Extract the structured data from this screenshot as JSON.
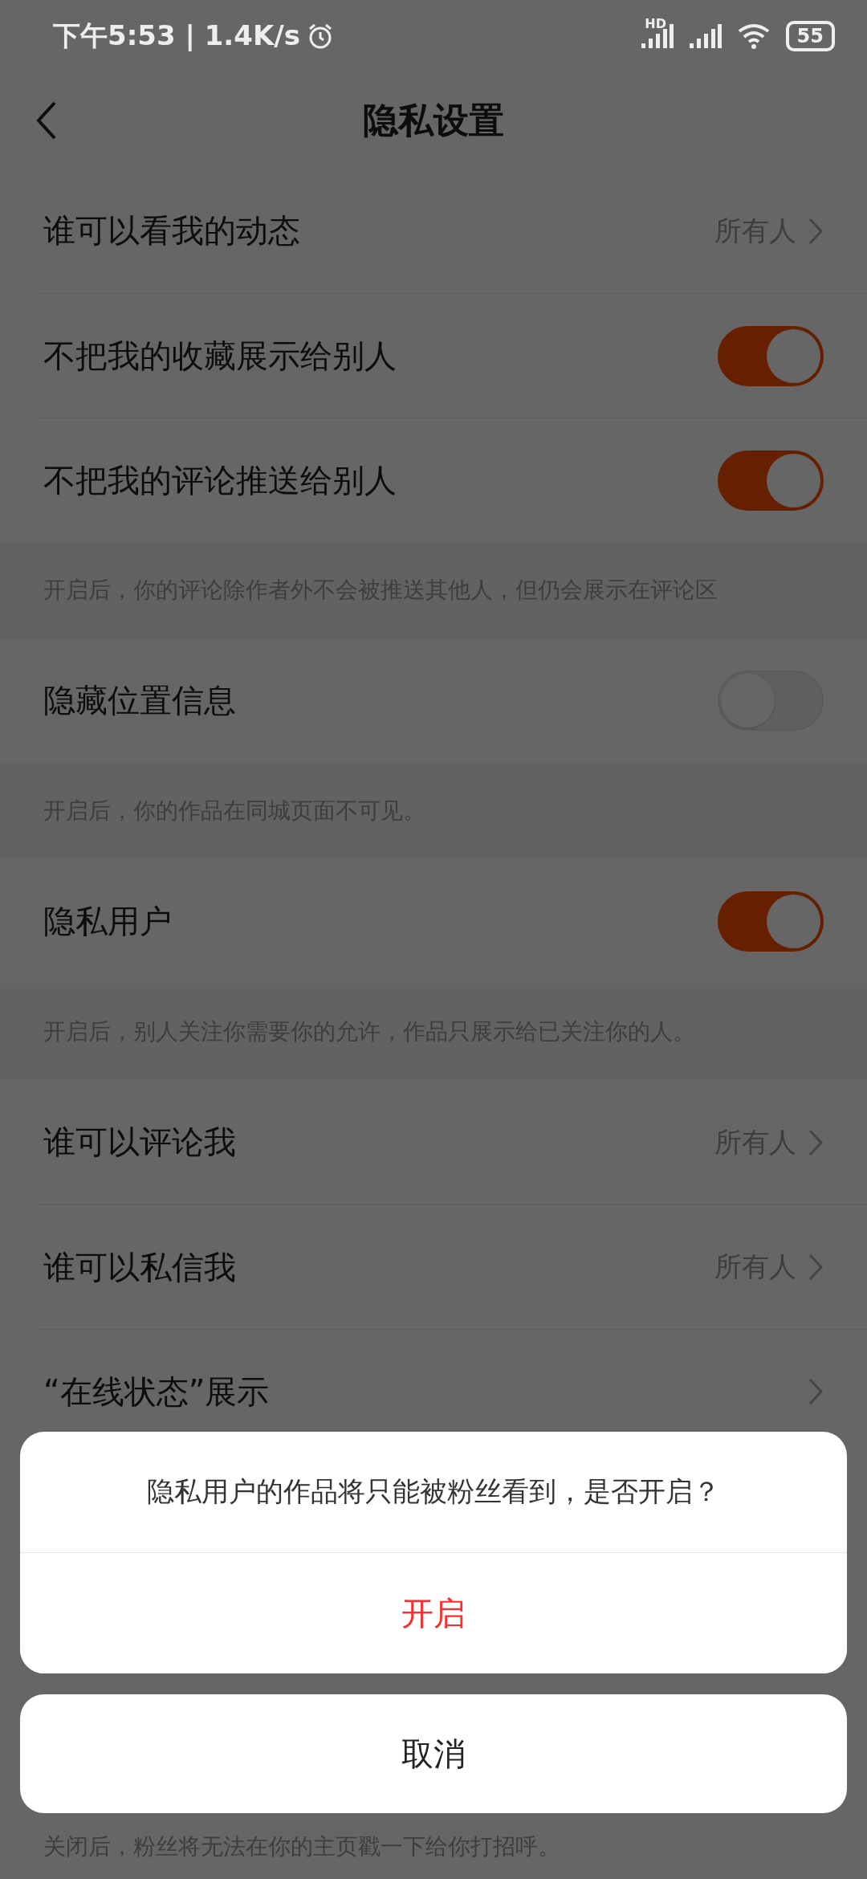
{
  "status_bar": {
    "time": "下午5:53 | 1.4K/s",
    "hd_label": "HD",
    "battery": "55"
  },
  "header": {
    "title": "隐私设置"
  },
  "items": [
    {
      "kind": "link",
      "label": "谁可以看我的动态",
      "value": "所有人"
    },
    {
      "kind": "toggle",
      "label": "不把我的收藏展示给别人",
      "on": true
    },
    {
      "kind": "toggle",
      "label": "不把我的评论推送给别人",
      "on": true
    },
    {
      "kind": "hint",
      "text": "开启后，你的评论除作者外不会被推送其他人，但仍会展示在评论区"
    },
    {
      "kind": "toggle",
      "label": "隐藏位置信息",
      "on": false
    },
    {
      "kind": "hint",
      "text": "开启后，你的作品在同城页面不可见。"
    },
    {
      "kind": "toggle",
      "label": "隐私用户",
      "on": true
    },
    {
      "kind": "hint",
      "text": "开启后，别人关注你需要你的允许，作品只展示给已关注你的人。"
    },
    {
      "kind": "link",
      "label": "谁可以评论我",
      "value": "所有人"
    },
    {
      "kind": "link",
      "label": "谁可以私信我",
      "value": "所有人"
    },
    {
      "kind": "link",
      "label": "“在线状态”展示"
    }
  ],
  "footer_hint": "关闭后，粉丝将无法在你的主页戳一下给你打招呼。",
  "dialog": {
    "message": "隐私用户的作品将只能被粉丝看到，是否开启？",
    "confirm": "开启",
    "cancel": "取消"
  }
}
